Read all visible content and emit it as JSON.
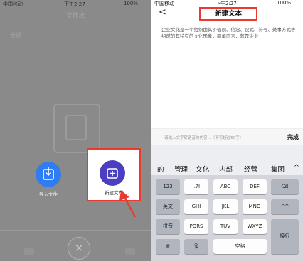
{
  "left_screen": {
    "status": {
      "carrier": "中国移动",
      "time": "下午2:27",
      "battery": "100%"
    },
    "title": "文件库",
    "filter": "全部",
    "actions": [
      {
        "label": "导入文件",
        "icon": "import-icon",
        "color": "#2f7cf5"
      },
      {
        "label": "新建文本",
        "icon": "new-text-icon",
        "color": "#4a3fc0"
      }
    ],
    "highlight_color": "#e83a2f",
    "close_icon": "×"
  },
  "right_screen": {
    "status": {
      "carrier": "中国移动",
      "time": "下午2:27",
      "battery": "100%"
    },
    "back_icon": "<",
    "title": "新建文本",
    "body_text": "企业文化是一个组织由其价值观、信念、仪式、符号、处事方式等组成的其特有的文化形象，简单而言，就是企业",
    "toolbar": {
      "placeholder": "请输入文字转语音的内容...（不可超过50字）",
      "done": "完成"
    },
    "candidates": [
      "的",
      "管理",
      "文化",
      "内部",
      "经营",
      "集团"
    ],
    "candidates_toggle": "^",
    "keys": {
      "row1": [
        "123",
        ",.?!",
        "ABC",
        "DEF",
        "⌫"
      ],
      "row2": [
        "英文",
        "GHI",
        "JKL",
        "MNO",
        "^^"
      ],
      "row3": [
        "拼音",
        "PQRS",
        "TUV",
        "WXYZ",
        "换行"
      ],
      "row4": [
        "⊕",
        "🎙",
        "空格"
      ]
    }
  }
}
